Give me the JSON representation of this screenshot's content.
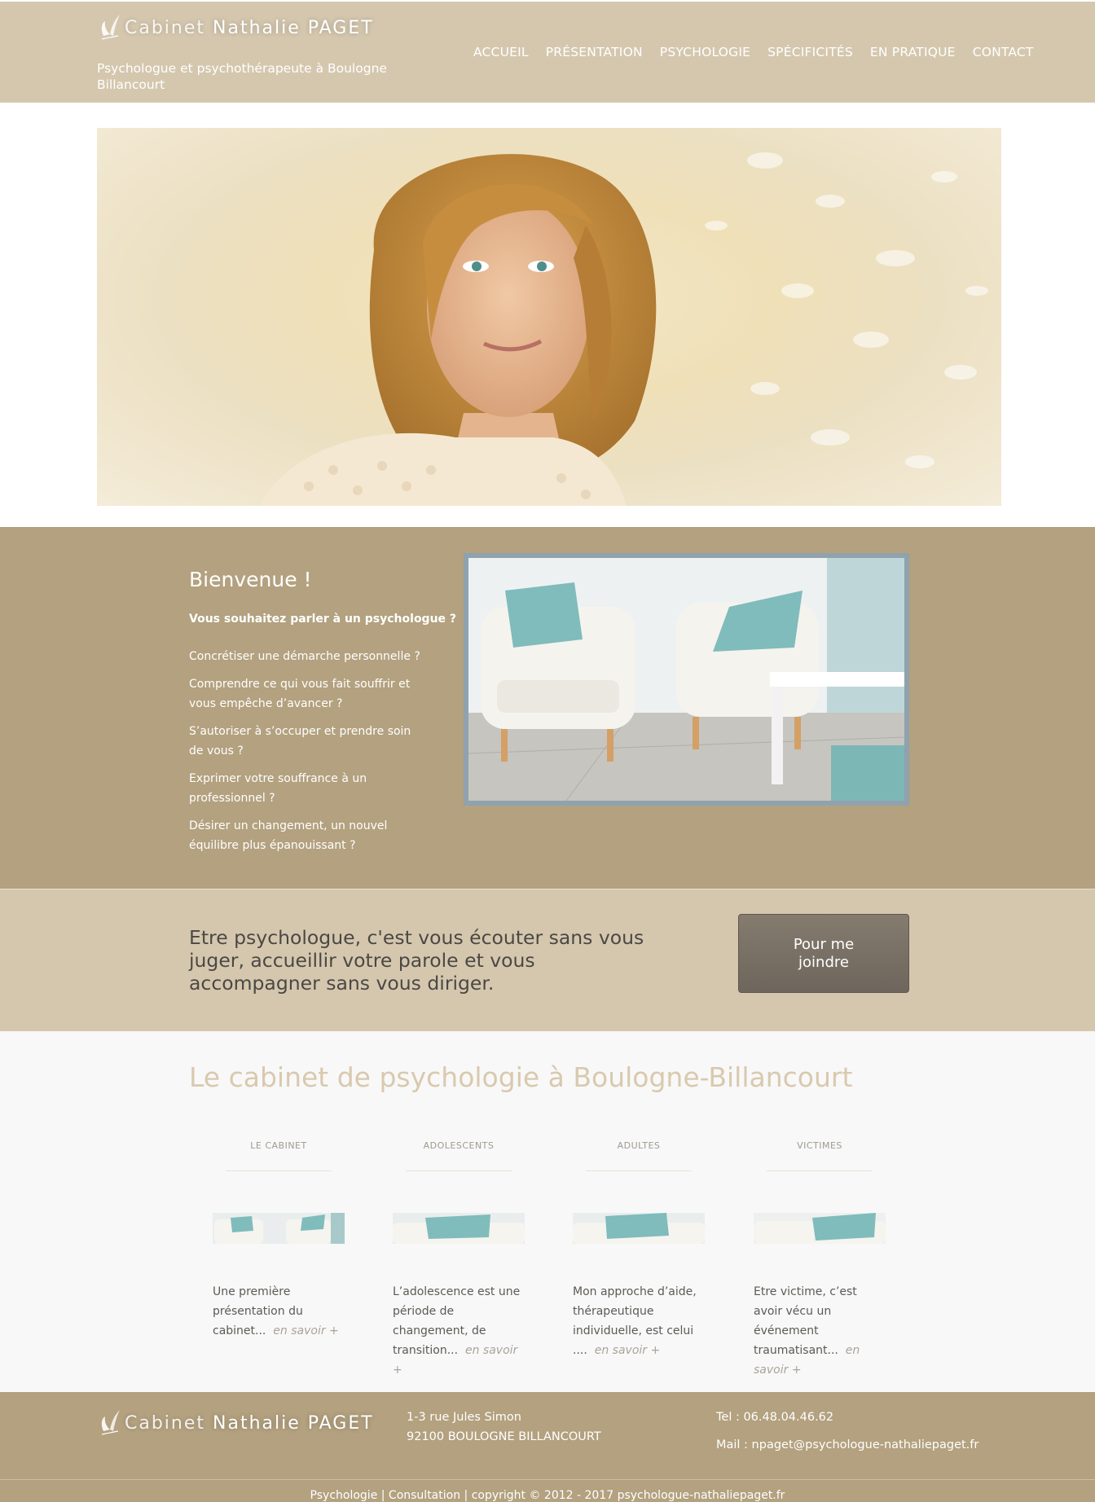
{
  "header": {
    "logo_light": "Cabinet",
    "logo_bold": "Nathalie PAGET",
    "tagline": "Psychologue et psychothérapeute à Boulogne Billancourt",
    "nav": [
      "ACCUEIL",
      "PRÉSENTATION",
      "PSYCHOLOGIE",
      "SPÉCIFICITÉS",
      "EN PRATIQUE",
      "CONTACT"
    ]
  },
  "welcome": {
    "title": "Bienvenue !",
    "lead": "Vous souhaitez parler à un psychologue ?",
    "items": [
      "Concrétiser une démarche personnelle ?",
      "Comprendre ce qui vous fait souffrir et vous empêche d’avancer ?",
      "S’autoriser à s’occuper et prendre soin de vous ?",
      "Exprimer votre souffrance à un professionnel ?",
      "Désirer un changement, un nouvel équilibre plus épanouissant ?"
    ]
  },
  "quote": {
    "text": "Etre psychologue, c'est vous écouter sans vous juger, accueillir votre parole et vous accompagner sans vous diriger.",
    "cta": "Pour me joindre"
  },
  "services": {
    "title": "Le cabinet de psychologie à Boulogne-Billancourt",
    "more_label": "en savoir +",
    "items": [
      {
        "title": "LE CABINET",
        "text": "Une première présentation du cabinet..."
      },
      {
        "title": "ADOLESCENTS",
        "text": "L’adolescence est une période de changement, de transition..."
      },
      {
        "title": "ADULTES",
        "text": "Mon approche d’aide, thérapeutique individuelle, est celui ...."
      },
      {
        "title": "VICTIMES",
        "text": "Etre victime, c’est avoir vécu un événement traumatisant..."
      }
    ]
  },
  "footer": {
    "logo_light": "Cabinet",
    "logo_bold": "Nathalie PAGET",
    "address_line1": "1-3 rue Jules Simon",
    "address_line2": "92100 BOULOGNE BILLANCOURT",
    "tel": "Tel : 06.48.04.46.62",
    "mail": "Mail : npaget@psychologue-nathaliepaget.fr",
    "copyright": "Psychologie | Consultation | copyright © 2012 - 2017 psychologue-nathaliepaget.fr"
  },
  "colors": {
    "header_bg": "#d5c7ae",
    "band_dark": "#b3a17f",
    "services_title": "#d9c9ae",
    "cta_bg": "#746b61"
  }
}
